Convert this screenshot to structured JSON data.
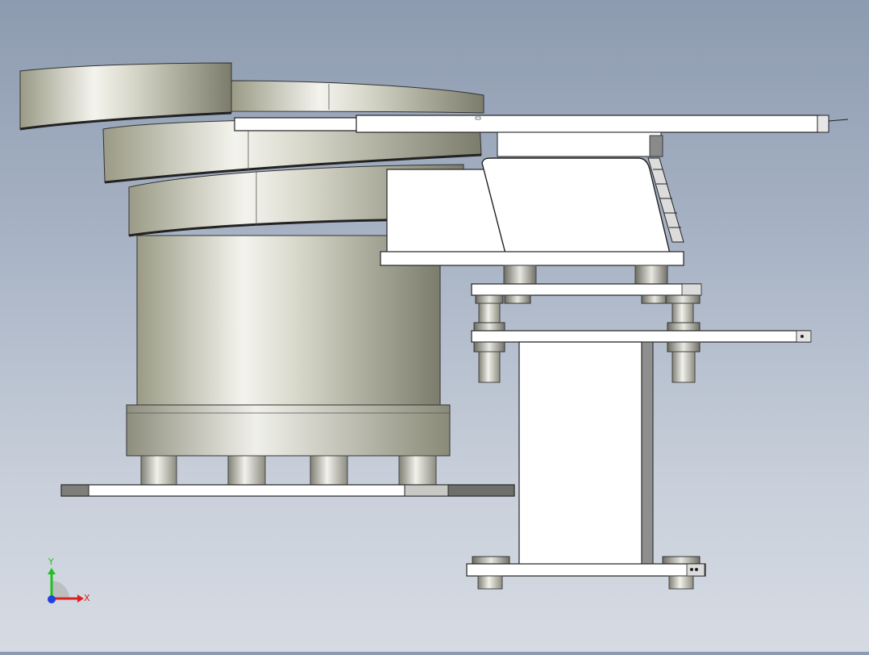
{
  "scene": {
    "title": "",
    "background_top": "#8d9bb0",
    "background_bottom": "#d6dbe3"
  },
  "triad": {
    "x_label": "X",
    "y_label": "Y",
    "x_color": "#e02020",
    "y_color": "#20c020",
    "z_color": "#2040e0"
  },
  "model": {
    "parts": [
      "vibratory-bowl",
      "bowl-base-plate",
      "linear-feeder-track",
      "linear-feeder-drive",
      "support-stand",
      "stand-base-plate"
    ]
  }
}
